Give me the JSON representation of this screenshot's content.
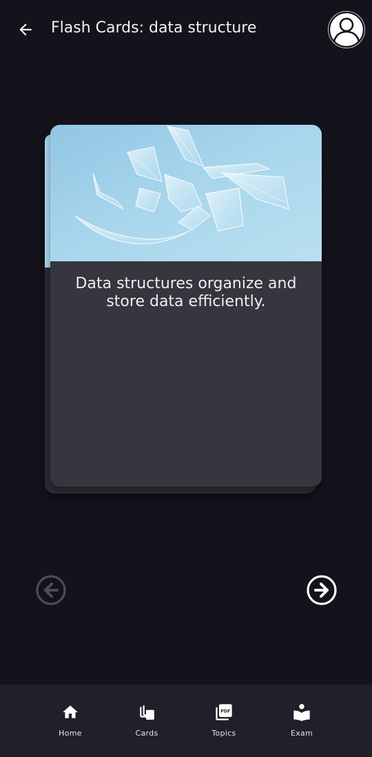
{
  "header": {
    "title": "Flash Cards: data structure"
  },
  "card": {
    "text": "Data structures organize and store data efficiently."
  },
  "bottom_nav": {
    "items": [
      {
        "label": "Home",
        "icon": "home-icon"
      },
      {
        "label": "Cards",
        "icon": "cards-icon"
      },
      {
        "label": "Topics",
        "icon": "pdf-icon"
      },
      {
        "label": "Exam",
        "icon": "exam-icon"
      }
    ]
  },
  "colors": {
    "background": "#14131c",
    "card": "#37363f",
    "card_back": "#2b2a33",
    "bottom_nav": "#211f29",
    "card_image_sky": "#a7d2ea"
  }
}
